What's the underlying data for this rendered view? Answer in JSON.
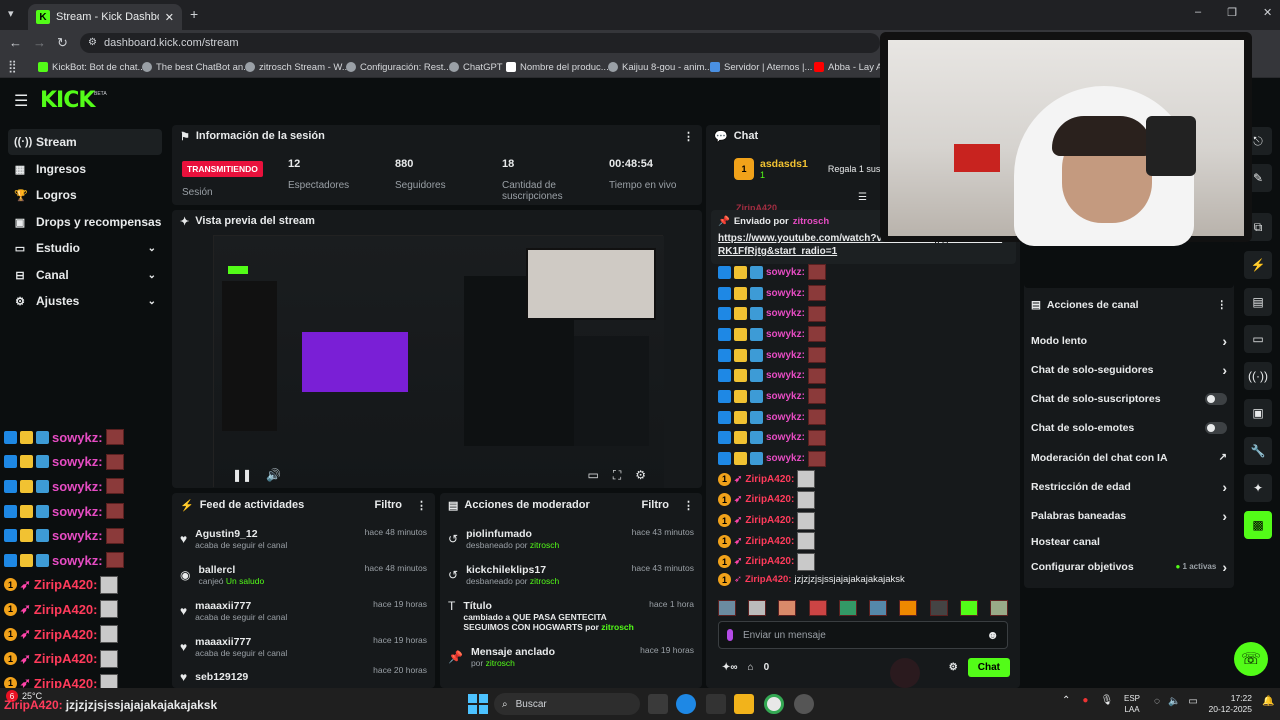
{
  "browser": {
    "tab_title": "Stream - Kick Dashboard",
    "url": "dashboard.kick.com/stream",
    "bookmarks": [
      "KickBot: Bot de chat...",
      "The best ChatBot an...",
      "zitrosch Stream - W...",
      "Configuración: Rest...",
      "ChatGPT",
      "Nombre del produc...",
      "Kaijuu 8-gou - anim...",
      "Servidor | Aternos |...",
      "Abba - Lay All"
    ]
  },
  "brand": {
    "logo": "KICK",
    "beta": "BETA",
    "accent": "#53fc18"
  },
  "sidebar": {
    "items": [
      {
        "label": "Stream",
        "icon": "broadcast-icon",
        "has_chevron": false
      },
      {
        "label": "Ingresos",
        "icon": "money-icon",
        "has_chevron": false
      },
      {
        "label": "Logros",
        "icon": "trophy-icon",
        "has_chevron": false
      },
      {
        "label": "Drops y recompensas",
        "icon": "gift-icon",
        "has_chevron": false
      },
      {
        "label": "Estudio",
        "icon": "studio-icon",
        "has_chevron": true
      },
      {
        "label": "Canal",
        "icon": "channel-icon",
        "has_chevron": true
      },
      {
        "label": "Ajustes",
        "icon": "gear-icon",
        "has_chevron": true
      }
    ]
  },
  "session": {
    "title": "Información de la sesión",
    "live_badge": "TRANSMITIENDO",
    "session_label": "Sesión",
    "stats": [
      {
        "value": "12",
        "label": "Espectadores"
      },
      {
        "value": "880",
        "label": "Seguidores"
      },
      {
        "value": "18",
        "label": "Cantidad de suscripciones"
      },
      {
        "value": "00:48:54",
        "label": "Tiempo en vivo"
      }
    ]
  },
  "preview": {
    "title": "Vista previa del stream"
  },
  "feed": {
    "title": "Feed de actividades",
    "filter": "Filtro",
    "items": [
      {
        "name": "Agustin9_12",
        "desc": "acaba de seguir el canal",
        "desc_green": "",
        "time": "hace 48 minutos",
        "icon": "heart-icon"
      },
      {
        "name": "ballercl",
        "desc": "canjeó",
        "desc_green": "Un saludo",
        "time": "hace 48 minutos",
        "icon": "reward-icon"
      },
      {
        "name": "maaaxii777",
        "desc": "acaba de seguir el canal",
        "desc_green": "",
        "time": "hace 19 horas",
        "icon": "heart-icon"
      },
      {
        "name": "maaaxii777",
        "desc": "acaba de seguir el canal",
        "desc_green": "",
        "time": "hace 19 horas",
        "icon": "heart-icon"
      },
      {
        "name": "seb129129",
        "desc": "",
        "desc_green": "",
        "time": "hace 20 horas",
        "icon": "heart-icon"
      }
    ]
  },
  "modlog": {
    "title": "Acciones de moderador",
    "filter": "Filtro",
    "items": [
      {
        "title": "piolinfumado",
        "desc": "desbaneado por",
        "by": "zitrosch",
        "time": "hace 43 minutos",
        "icon": "unban-icon"
      },
      {
        "title": "kickchileklips17",
        "desc": "desbaneado por",
        "by": "zitrosch",
        "time": "hace 43 minutos",
        "icon": "unban-icon"
      },
      {
        "title": "Título",
        "desc": "cambiado a QUE PASA GENTECITA SEGUIMOS CON HOGWARTS por",
        "by": "zitrosch",
        "time": "hace 1 hora",
        "icon": "title-icon"
      },
      {
        "title": "Mensaje anclado",
        "desc": "por",
        "by": "zitrosch",
        "time": "hace 19 horas",
        "icon": "pin-icon"
      }
    ]
  },
  "chat": {
    "title": "Chat",
    "gifter": "asdasds1",
    "gift_count": "1",
    "gift_text": "Regala 1 suscri",
    "pinned_by_label": "Enviado por",
    "pinned_by": "zitrosch",
    "pinned_link": "https://www.youtube.com/watch?v=xoRK1FfRjtg&list=RDxoRK1FfRjtg&start_radio=1",
    "top_user": "ZiripA420",
    "user1": "sowykz:",
    "user2": "ZiripA420:",
    "last_msg_user": "ZiripA420:",
    "last_msg": "jzjzjzjsjssjajajakajakajaksk",
    "input_placeholder": "Enviar un mensaje",
    "points": "0",
    "send": "Chat"
  },
  "channel_actions": {
    "title": "Acciones de canal",
    "rows": [
      {
        "label": "Modo lento",
        "control": "chevron"
      },
      {
        "label": "Chat de solo-seguidores",
        "control": "chevron"
      },
      {
        "label": "Chat de solo-suscriptores",
        "control": "toggle"
      },
      {
        "label": "Chat de solo-emotes",
        "control": "toggle"
      },
      {
        "label": "Moderación del chat con IA",
        "control": "external"
      },
      {
        "label": "Restricción de edad",
        "control": "chevron"
      },
      {
        "label": "Palabras baneadas",
        "control": "chevron"
      },
      {
        "label": "Hostear canal",
        "control": "none"
      },
      {
        "label": "Configurar objetivos",
        "control": "badge",
        "badge": "1 activas"
      }
    ]
  },
  "overlay": {
    "user1": "sowykz:",
    "user2": "ZiripA420:",
    "last_msg": "jzjzjzjsjssjajajakajakajaksk",
    "notif": "6"
  },
  "taskbar": {
    "search": "Buscar",
    "temp": "25°C",
    "lang1": "ESP",
    "lang2": "LAA",
    "time": "17:22",
    "date": "20-12-2025"
  }
}
